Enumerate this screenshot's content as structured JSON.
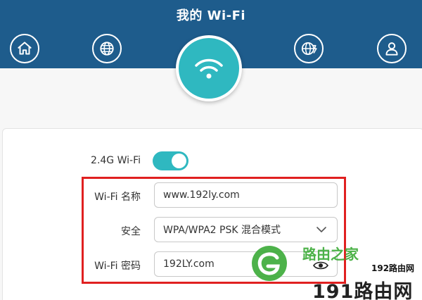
{
  "header": {
    "title": "我的 Wi-Fi",
    "nav_icons": [
      "home-icon",
      "globe-icon",
      "wifi-icon",
      "globe-settings-icon",
      "user-icon"
    ]
  },
  "wifi_settings": {
    "toggle_label": "2.4G Wi-Fi",
    "toggle_on": true,
    "name_label": "Wi-Fi 名称",
    "name_value": "www.192ly.com",
    "security_label": "安全",
    "security_value": "WPA/WPA2 PSK 混合模式",
    "password_label": "Wi-Fi 密码",
    "password_value": "192LY.com"
  },
  "watermark": {
    "brand_cn": "路由之家",
    "brand_192": "192路由网",
    "brand_191": "191路由网"
  },
  "colors": {
    "header_bg": "#1e5c8c",
    "accent": "#2fb8c0",
    "highlight": "#e02020",
    "watermark_green": "#3aaa36"
  }
}
